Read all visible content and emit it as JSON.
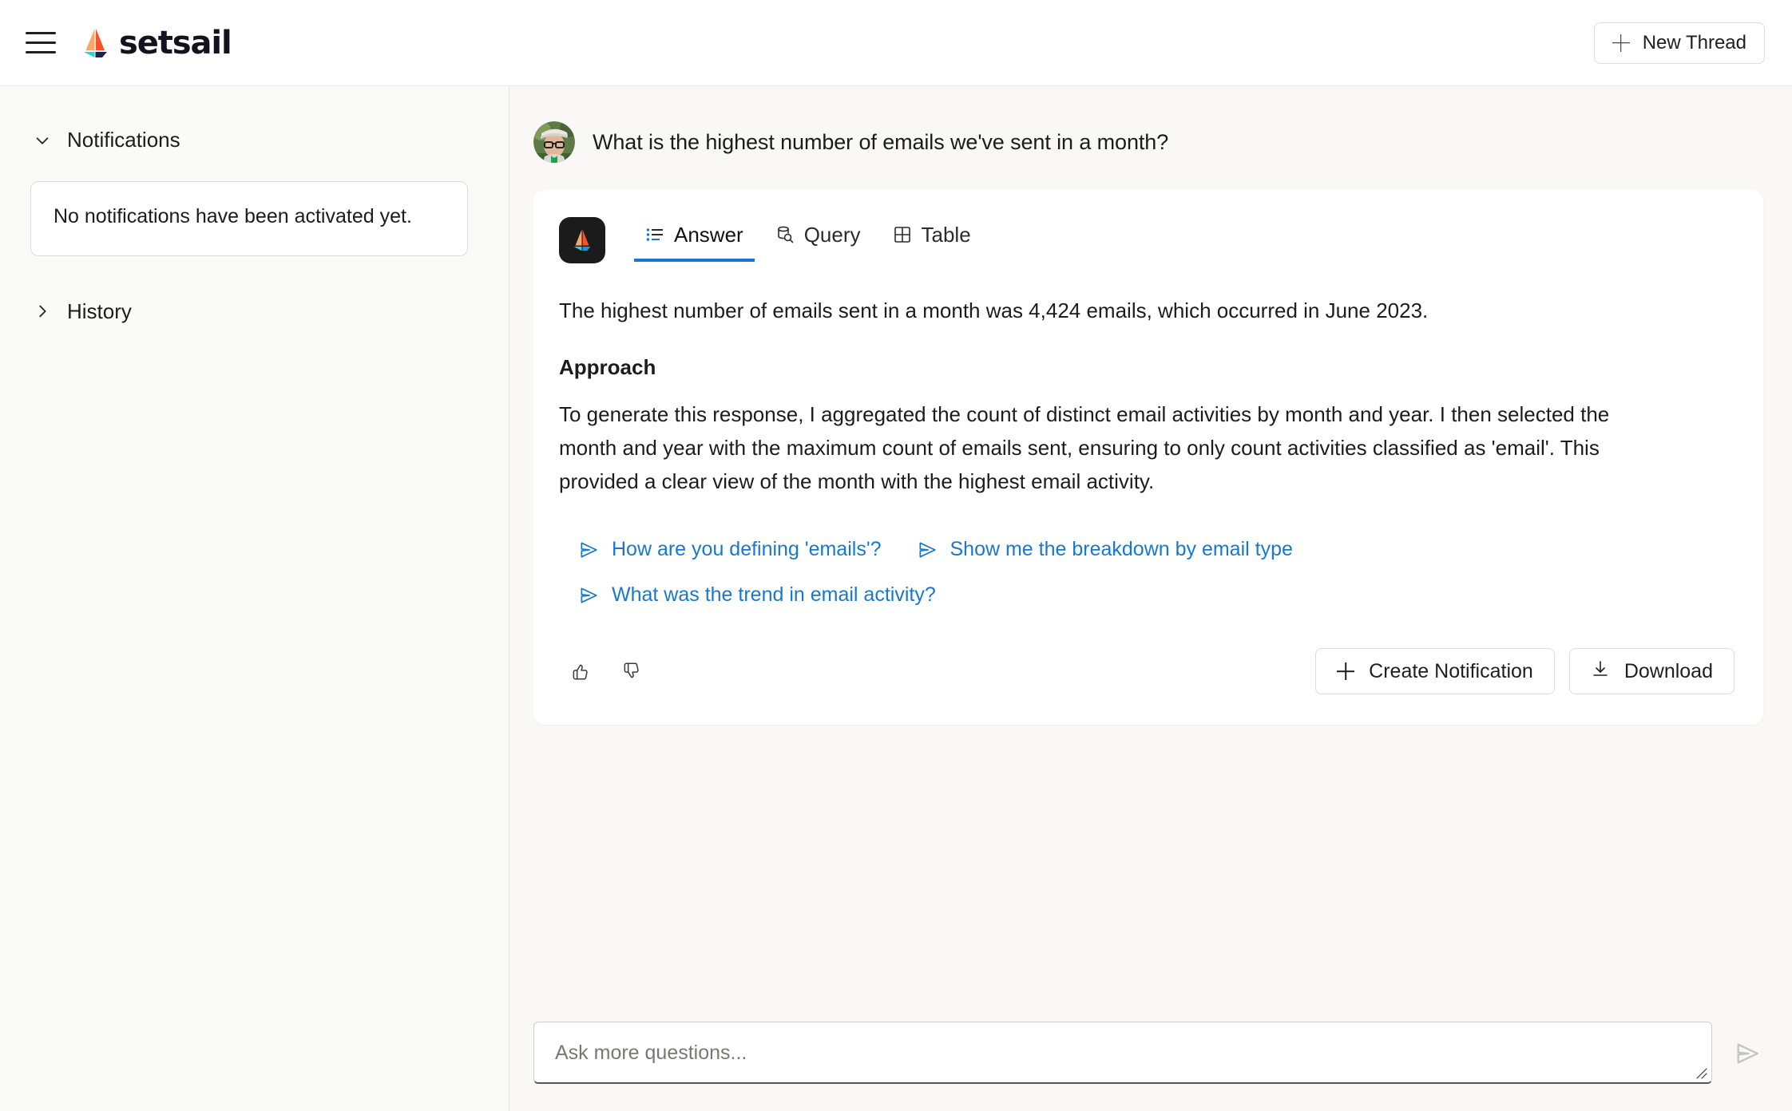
{
  "header": {
    "menu_icon": "hamburger-menu-icon",
    "logo_icon": "setsail-sailboat-logo",
    "brand_name": "setsail",
    "new_thread_label": "New Thread",
    "new_thread_icon": "plus-icon"
  },
  "sidebar": {
    "sections": [
      {
        "label": "Notifications",
        "icon": "chevron-down-icon",
        "expanded": true
      },
      {
        "label": "History",
        "icon": "chevron-right-icon",
        "expanded": false
      }
    ],
    "notifications_empty_text": "No notifications have been activated yet."
  },
  "main": {
    "user_question": "What is the highest number of emails we've sent in a month?",
    "avatar_icon": "user-avatar-photo",
    "assistant_icon": "setsail-app-badge-icon",
    "tabs": [
      {
        "label": "Answer",
        "icon": "list-icon",
        "active": true
      },
      {
        "label": "Query",
        "icon": "database-search-icon",
        "active": false
      },
      {
        "label": "Table",
        "icon": "grid-table-icon",
        "active": false
      }
    ],
    "answer_lead": "The highest number of emails sent in a month was 4,424 emails, which occurred in June 2023.",
    "approach_heading": "Approach",
    "approach_body": "To generate this response, I aggregated the count of distinct email activities by month and year. I then selected the month and year with the maximum count of emails sent, ensuring to only count activities classified as 'email'. This provided a clear view of the month with the highest email activity.",
    "suggestions": [
      {
        "label": "How are you defining 'emails'?",
        "icon": "send-triangle-icon"
      },
      {
        "label": "Show me the breakdown by email type",
        "icon": "send-triangle-icon"
      },
      {
        "label": "What was the trend in email activity?",
        "icon": "send-triangle-icon"
      }
    ],
    "feedback": {
      "thumbs_up_icon": "thumbs-up-icon",
      "thumbs_down_icon": "thumbs-down-icon"
    },
    "actions": [
      {
        "label": "Create Notification",
        "icon": "plus-icon"
      },
      {
        "label": "Download",
        "icon": "download-icon"
      }
    ]
  },
  "composer": {
    "placeholder": "Ask more questions...",
    "value": "",
    "send_icon": "send-triangle-icon",
    "resize_icon": "resize-grip-icon"
  },
  "colors": {
    "accent_blue": "#1878d0",
    "brand_orange": "#f86a3c",
    "brand_peach": "#fba76a",
    "brand_teal": "#2ad4d4",
    "brand_navy": "#1b2356",
    "page_bg": "#f9f8f6",
    "sidebar_bg": "#fafaf9",
    "card_bg": "#ffffff",
    "text": "#1c1c1c",
    "border": "#e6e6e4"
  }
}
